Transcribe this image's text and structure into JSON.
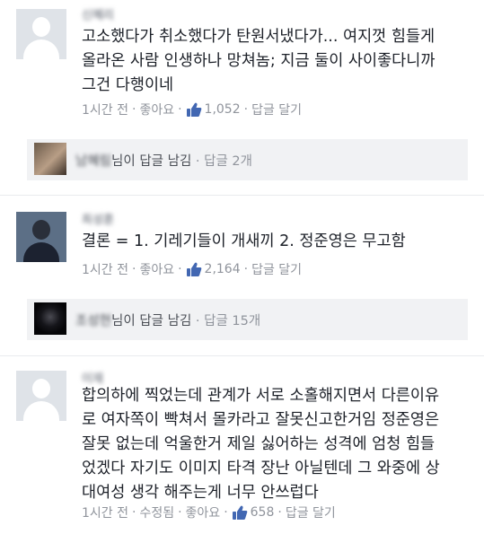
{
  "comments": [
    {
      "author": "신혜리",
      "lines": [
        "고소했다가 취소했다가 탄원서냈다가... 여지껏 힘들게",
        "올라온 사람 인생하나 망쳐놈; 지금 둘이 사이좋다니까",
        "그건 다행이네"
      ],
      "time": "1시간 전",
      "like_label": "좋아요",
      "like_count": "1,052",
      "reply_label": "답글 달기",
      "reply_summary": {
        "name": "남혜림",
        "suffix": "님이 답글 남김",
        "count": "답글 2개"
      }
    },
    {
      "author": "최성훈",
      "lines": [
        "결론 = 1. 기레기들이 개새끼 2. 정준영은 무고함"
      ],
      "time": "1시간 전",
      "like_label": "좋아요",
      "like_count": "2,164",
      "reply_label": "답글 달기",
      "reply_summary": {
        "name": "조성현",
        "suffix": "님이 답글 남김",
        "count": "답글 15개"
      }
    },
    {
      "author": "이재",
      "lines": [
        "합의하에 찍었는데 관계가 서로 소홀해지면서 다른이유",
        "로 여자쪽이 빡쳐서 몰카라고 잘못신고한거임 정준영은",
        "잘못 없는데 억울한거 제일 싫어하는 성격에 엄청 힘들",
        "었겠다 자기도 이미지 타격 장난 아닐텐데 그 와중에 상",
        "대여성 생각 해주는게 너무 안쓰럽다"
      ],
      "time": "1시간 전",
      "edited_label": "수정됨",
      "like_label": "좋아요",
      "like_count": "658",
      "reply_label": "답글 달기"
    }
  ],
  "colors": {
    "text": "#1d2129",
    "meta": "#90949c",
    "like_blue": "#4267b2",
    "reply_bg": "#f1f2f4"
  },
  "icons": {
    "avatar": "default-avatar",
    "like": "thumbs-up-icon"
  }
}
